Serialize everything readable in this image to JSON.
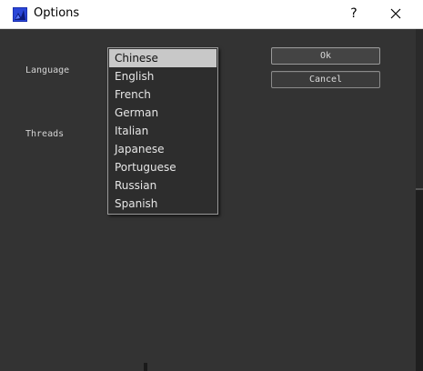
{
  "window": {
    "title": "Options",
    "help_label": "?",
    "icon": "app-icon",
    "close_icon": "close-icon"
  },
  "form": {
    "language_label": "Language",
    "threads_label": "Threads"
  },
  "buttons": {
    "ok_label": "Ok",
    "cancel_label": "Cancel"
  },
  "language_dropdown": {
    "selected": "Chinese",
    "options": [
      "Chinese",
      "English",
      "French",
      "German",
      "Italian",
      "Japanese",
      "Portuguese",
      "Russian",
      "Spanish"
    ]
  },
  "colors": {
    "background": "#333333",
    "titlebar": "#ffffff",
    "highlight": "#c8c8c8"
  }
}
